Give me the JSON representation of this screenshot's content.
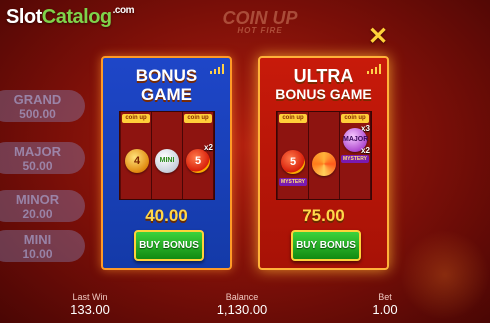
{
  "watermark": {
    "slot": "Slot",
    "catalog": "Catalog",
    "com": ".com"
  },
  "game_logo": {
    "name": "COIN UP",
    "sub": "HOT FIRE"
  },
  "close": {
    "icon": "✕"
  },
  "jackpots": [
    {
      "name": "GRAND",
      "value": "500.00"
    },
    {
      "name": "MAJOR",
      "value": "50.00"
    },
    {
      "name": "MINOR",
      "value": "20.00"
    },
    {
      "name": "MINI",
      "value": "10.00"
    }
  ],
  "bonus_panel": {
    "title_line1": "BONUS",
    "title_line2": "GAME",
    "tag_left": "coin up",
    "tag_right": "coin up",
    "coins": [
      {
        "label": "4",
        "kind": "gold"
      },
      {
        "label": "MINI",
        "kind": "mini"
      },
      {
        "label": "5",
        "kind": "red",
        "multiplier": "x2"
      }
    ],
    "price": "40.00",
    "button": "BUY BONUS"
  },
  "ultra_panel": {
    "title_line1": "ULTRA",
    "title_line2": "BONUS GAME",
    "tag_left": "coin up",
    "tag_right": "coin up",
    "coins": [
      {
        "label": "5",
        "kind": "red"
      },
      {
        "label": "",
        "kind": "swirl"
      },
      {
        "label": "MAJOR",
        "kind": "major",
        "multiplier": "x2"
      }
    ],
    "badge_left": "MYSTERY",
    "badge_right": "MYSTERY",
    "top_multiplier": "x3",
    "price": "75.00",
    "button": "BUY BONUS"
  },
  "footer": {
    "last_win_label": "Last Win",
    "last_win_value": "133.00",
    "balance_label": "Balance",
    "balance_value": "1,130.00",
    "bet_label": "Bet",
    "bet_value": "1.00"
  },
  "colors": {
    "bonus_panel": "#1e46c8",
    "ultra_panel": "#c81a0a",
    "accent_gold": "#ffd84a",
    "buy_button": "#2bb52b"
  }
}
